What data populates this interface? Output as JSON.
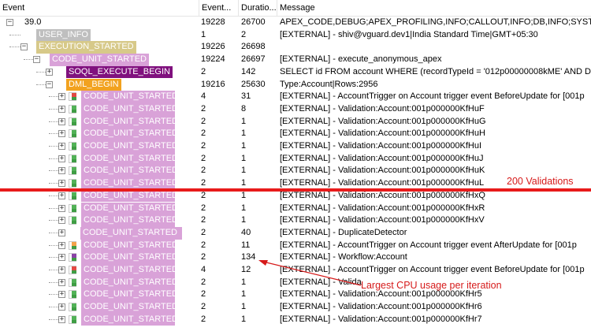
{
  "columns": {
    "event": "Event",
    "count": "Event...",
    "duration": "Duratio...",
    "message": "Message"
  },
  "colors": {
    "grey": "#bfbfbf",
    "olive": "#d7c989",
    "pink": "#d9a2d8",
    "purple": "#80117e",
    "orange": "#f2a21f",
    "annotation": "#e81b1b"
  },
  "rows": [
    {
      "label": "39.0",
      "count": "19228",
      "duration": "26700",
      "message": "APEX_CODE,DEBUG;APEX_PROFILING,INFO;CALLOUT,INFO;DB,INFO;SYSTEM",
      "style": "plain",
      "depth": 0,
      "expander": "−",
      "icon": ""
    },
    {
      "label": "USER_INFO",
      "count": "1",
      "duration": "2",
      "message": "[EXTERNAL] - shiv@vguard.dev1|India Standard Time|GMT+05:30",
      "style": "grey",
      "depth": 1,
      "expander": "",
      "icon": ""
    },
    {
      "label": "EXECUTION_STARTED",
      "count": "19226",
      "duration": "26698",
      "message": "",
      "style": "olive",
      "depth": 1,
      "expander": "−",
      "icon": ""
    },
    {
      "label": "CODE_UNIT_STARTED",
      "count": "19224",
      "duration": "26697",
      "message": "[EXTERNAL] - execute_anonymous_apex",
      "style": "pink",
      "depth": 2,
      "expander": "−",
      "icon": ""
    },
    {
      "label": "SOQL_EXECUTE_BEGIN",
      "count": "2",
      "duration": "142",
      "message": "SELECT id FROM account WHERE (recordTypeId = '012p00000008kME' AND D",
      "style": "purple",
      "depth": 3,
      "expander": "+",
      "icon": ""
    },
    {
      "label": "DML_BEGIN",
      "count": "19216",
      "duration": "25630",
      "message": "Type:Account|Rows:2956",
      "style": "orange",
      "depth": 3,
      "expander": "−",
      "icon": ""
    },
    {
      "label": "CODE_UNIT_STARTED",
      "count": "4",
      "duration": "31",
      "message": "[EXTERNAL] - AccountTrigger on Account trigger event BeforeUpdate for [001p",
      "style": "pink",
      "depth": 4,
      "expander": "+",
      "icon": "red"
    },
    {
      "label": "CODE_UNIT_STARTED",
      "count": "2",
      "duration": "8",
      "message": "[EXTERNAL] - Validation:Account:001p000000KfHuF",
      "style": "pink",
      "depth": 4,
      "expander": "+",
      "icon": "green"
    },
    {
      "label": "CODE_UNIT_STARTED",
      "count": "2",
      "duration": "1",
      "message": "[EXTERNAL] - Validation:Account:001p000000KfHuG",
      "style": "pink",
      "depth": 4,
      "expander": "+",
      "icon": "green"
    },
    {
      "label": "CODE_UNIT_STARTED",
      "count": "2",
      "duration": "1",
      "message": "[EXTERNAL] - Validation:Account:001p000000KfHuH",
      "style": "pink",
      "depth": 4,
      "expander": "+",
      "icon": "green"
    },
    {
      "label": "CODE_UNIT_STARTED",
      "count": "2",
      "duration": "1",
      "message": "[EXTERNAL] - Validation:Account:001p000000KfHuI",
      "style": "pink",
      "depth": 4,
      "expander": "+",
      "icon": "green"
    },
    {
      "label": "CODE_UNIT_STARTED",
      "count": "2",
      "duration": "1",
      "message": "[EXTERNAL] - Validation:Account:001p000000KfHuJ",
      "style": "pink",
      "depth": 4,
      "expander": "+",
      "icon": "green"
    },
    {
      "label": "CODE_UNIT_STARTED",
      "count": "2",
      "duration": "1",
      "message": "[EXTERNAL] - Validation:Account:001p000000KfHuK",
      "style": "pink",
      "depth": 4,
      "expander": "+",
      "icon": "green"
    },
    {
      "label": "CODE_UNIT_STARTED",
      "count": "2",
      "duration": "1",
      "message": "[EXTERNAL] - Validation:Account:001p000000KfHuL",
      "style": "pink",
      "depth": 4,
      "expander": "+",
      "icon": "green"
    },
    {
      "label": "CODE_UNIT_STARTED",
      "count": "2",
      "duration": "1",
      "message": "[EXTERNAL] - Validation:Account:001p000000KfHxQ",
      "style": "pink",
      "depth": 4,
      "expander": "+",
      "icon": "green"
    },
    {
      "label": "CODE_UNIT_STARTED",
      "count": "2",
      "duration": "1",
      "message": "[EXTERNAL] - Validation:Account:001p000000KfHxR",
      "style": "pink",
      "depth": 4,
      "expander": "+",
      "icon": "green"
    },
    {
      "label": "CODE_UNIT_STARTED",
      "count": "2",
      "duration": "1",
      "message": "[EXTERNAL] - Validation:Account:001p000000KfHxV",
      "style": "pink",
      "depth": 4,
      "expander": "+",
      "icon": "green"
    },
    {
      "label": "CODE_UNIT_STARTED",
      "count": "2",
      "duration": "40",
      "message": "[EXTERNAL] - DuplicateDetector",
      "style": "pink",
      "depth": 4,
      "expander": "+",
      "icon": ""
    },
    {
      "label": "CODE_UNIT_STARTED",
      "count": "2",
      "duration": "11",
      "message": "[EXTERNAL] - AccountTrigger on Account trigger event AfterUpdate for [001p",
      "style": "pink",
      "depth": 4,
      "expander": "+",
      "icon": "orange"
    },
    {
      "label": "CODE_UNIT_STARTED",
      "count": "2",
      "duration": "134",
      "message": "[EXTERNAL] - Workflow:Account",
      "style": "pink",
      "depth": 4,
      "expander": "+",
      "icon": "purple"
    },
    {
      "label": "CODE_UNIT_STARTED",
      "count": "4",
      "duration": "12",
      "message": "[EXTERNAL] - AccountTrigger on Account trigger event BeforeUpdate for [001p",
      "style": "pink",
      "depth": 4,
      "expander": "+",
      "icon": "red"
    },
    {
      "label": "CODE_UNIT_STARTED",
      "count": "2",
      "duration": "1",
      "message": "[EXTERNAL] - Valida",
      "style": "pink",
      "depth": 4,
      "expander": "+",
      "icon": "green"
    },
    {
      "label": "CODE_UNIT_STARTED",
      "count": "2",
      "duration": "1",
      "message": "[EXTERNAL] - Validation:Account:001p000000KfHr5",
      "style": "pink",
      "depth": 4,
      "expander": "+",
      "icon": "green"
    },
    {
      "label": "CODE_UNIT_STARTED",
      "count": "2",
      "duration": "1",
      "message": "[EXTERNAL] - Validation:Account:001p000000KfHr6",
      "style": "pink",
      "depth": 4,
      "expander": "+",
      "icon": "green"
    },
    {
      "label": "CODE_UNIT_STARTED",
      "count": "2",
      "duration": "1",
      "message": "[EXTERNAL] - Validation:Account:001p000000KfHr7",
      "style": "pink",
      "depth": 4,
      "expander": "+",
      "icon": "green"
    }
  ],
  "annotations": {
    "validations": "200 Validations",
    "cpu": "Largest CPU usage per iteration"
  }
}
